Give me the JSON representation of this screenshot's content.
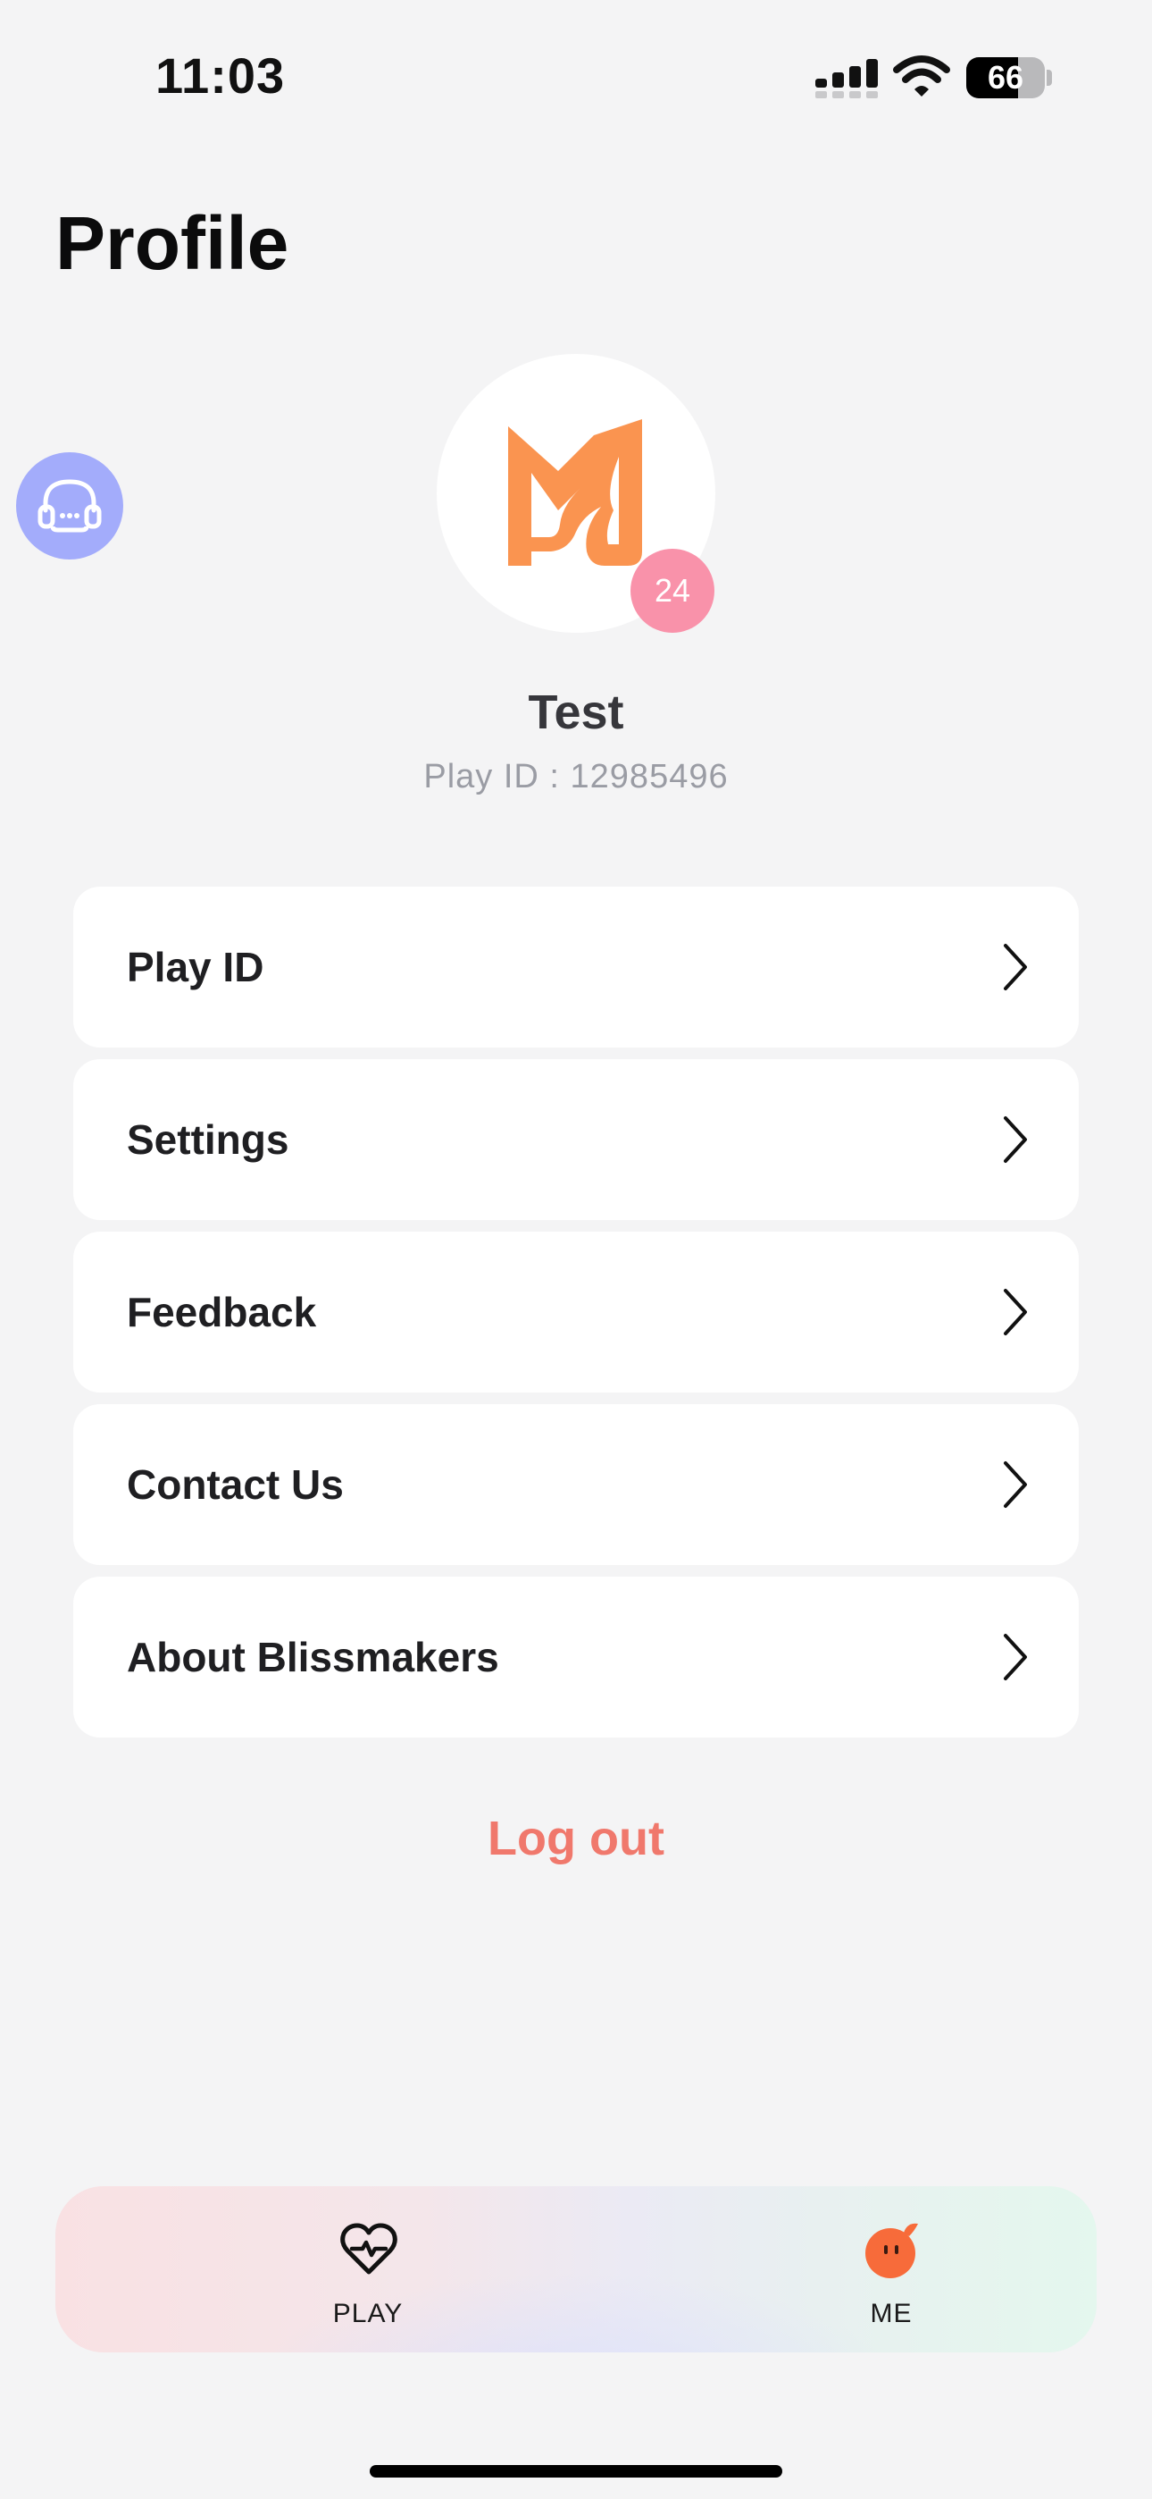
{
  "status_bar": {
    "time": "11:03",
    "battery_level": "66",
    "battery_fraction": 0.66
  },
  "header": {
    "title": "Profile"
  },
  "support": {
    "icon": "headset-icon",
    "color": "#a3acfb"
  },
  "profile": {
    "logo_icon": "blissmakers-logo-icon",
    "logo_color": "#fa9450",
    "level_badge": "24",
    "name": "Test",
    "play_id_text": "Play ID : 12985496"
  },
  "menu": {
    "items": [
      {
        "label": "Play ID",
        "icon": "chevron-right-icon"
      },
      {
        "label": "Settings",
        "icon": "chevron-right-icon"
      },
      {
        "label": "Feedback",
        "icon": "chevron-right-icon"
      },
      {
        "label": "Contact Us",
        "icon": "chevron-right-icon"
      },
      {
        "label": "About Blissmakers",
        "icon": "chevron-right-icon"
      }
    ]
  },
  "logout": {
    "label": "Log out",
    "color": "#f0786c"
  },
  "tab_bar": {
    "tabs": [
      {
        "label": "PLAY",
        "icon": "heart-pulse-icon"
      },
      {
        "label": "ME",
        "icon": "character-face-icon",
        "active": true
      }
    ]
  }
}
